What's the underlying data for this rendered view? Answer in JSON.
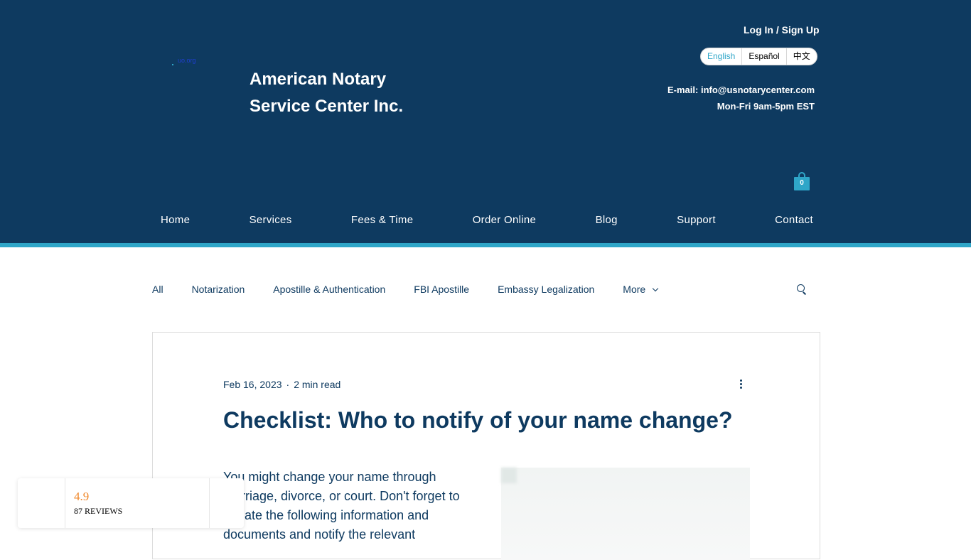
{
  "header": {
    "logo_text": "uo.org",
    "company_name_line1": "American Notary",
    "company_name_line2": "Service Center Inc.",
    "login_label": "Log In / Sign Up",
    "languages": [
      "English",
      "Español",
      "中文"
    ],
    "active_language": "English",
    "email": "E-mail: info@usnotarycenter.com",
    "hours": "Mon-Fri 9am-5pm EST",
    "cart_count": "0"
  },
  "nav": [
    "Home",
    "Services",
    "Fees & Time",
    "Order Online",
    "Blog",
    "Support",
    "Contact"
  ],
  "categories": {
    "items": [
      "All",
      "Notarization",
      "Apostille & Authentication",
      "FBI Apostille",
      "Embassy Legalization"
    ],
    "more_label": "More"
  },
  "post": {
    "date": "Feb 16, 2023",
    "separator": "·",
    "read_time": "2 min read",
    "title": "Checklist: Who to notify of your name change?",
    "body": "You might change your name through marriage, divorce, or court. Don't forget to update the following information and documents and notify the relevant"
  },
  "reviews": {
    "score": "4.9",
    "count": "87 REVIEWS"
  },
  "colors": {
    "header_bg": "#0e3a60",
    "accent": "#2fa6c8",
    "text_dark": "#0e3a60",
    "review_score": "#f08a2e"
  },
  "icons": [
    "cart-icon",
    "chevron-down-icon",
    "search-icon",
    "more-vertical-icon"
  ]
}
